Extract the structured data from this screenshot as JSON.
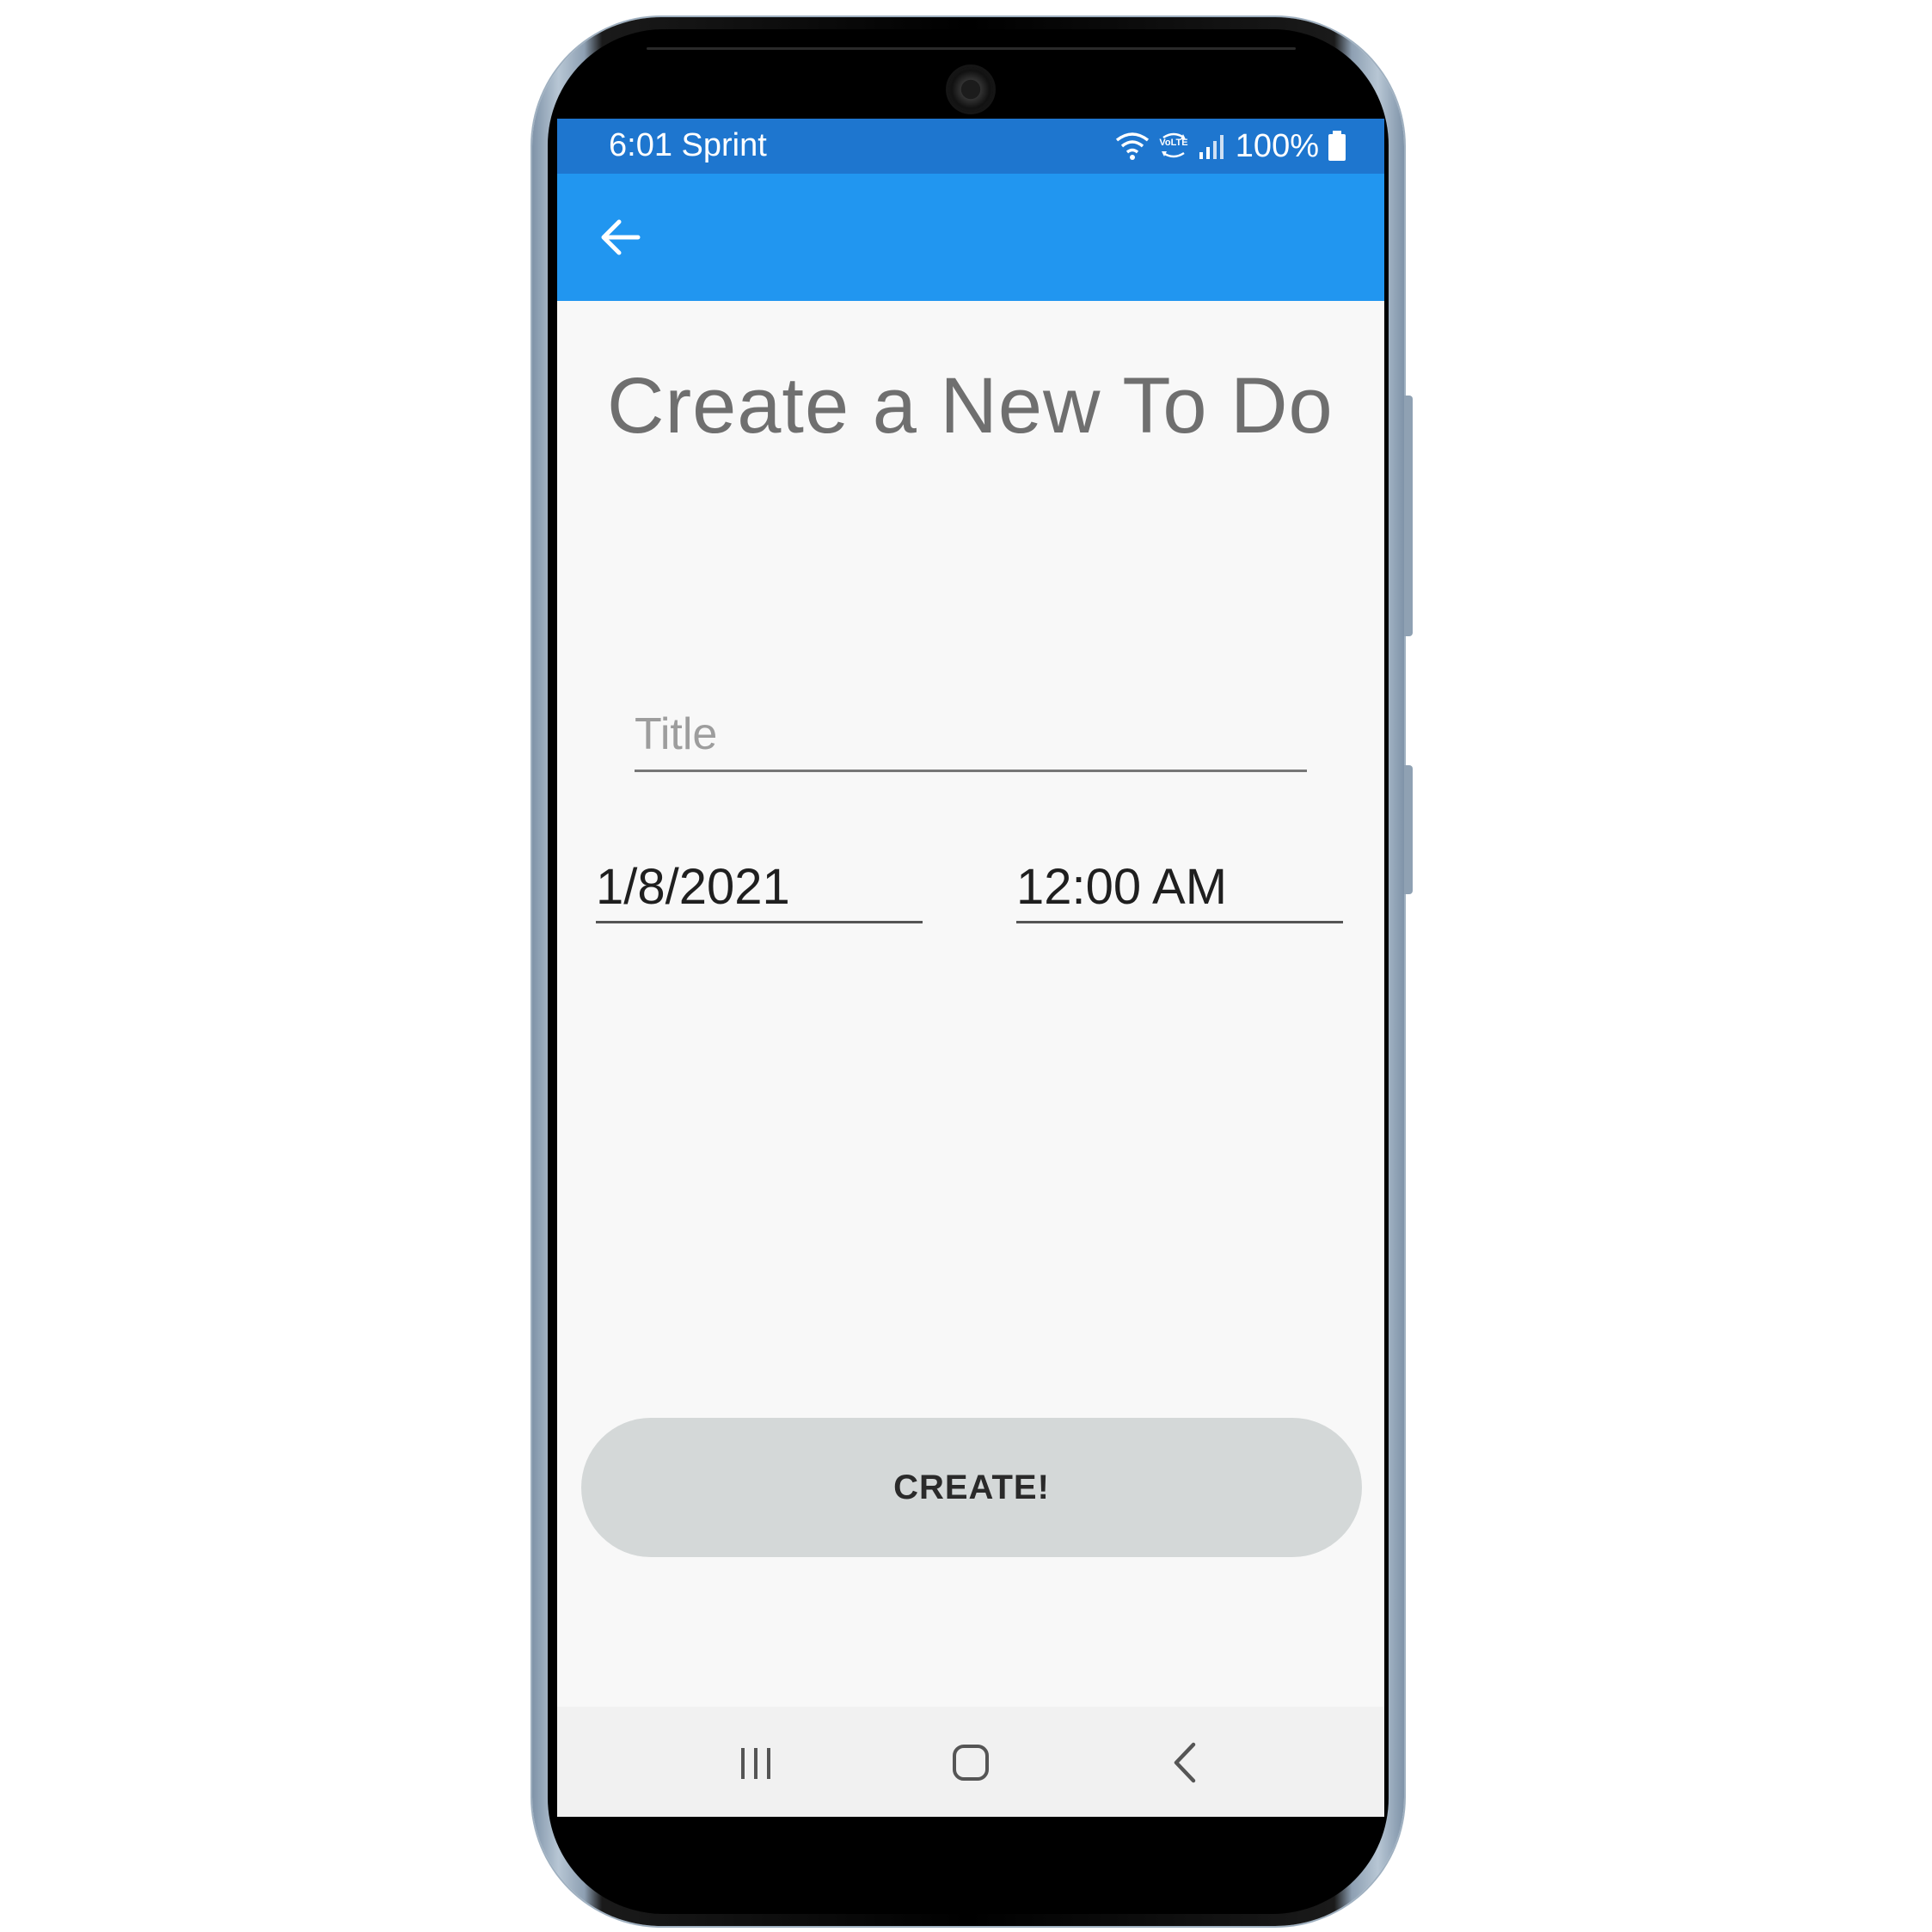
{
  "status_bar": {
    "time_carrier": "6:01 Sprint",
    "battery_percent": "100%",
    "icons": [
      "wifi-icon",
      "volte-icon",
      "signal-icon",
      "battery-icon"
    ]
  },
  "app_bar": {
    "back_icon": "arrow-left-icon",
    "color": "#2196f0"
  },
  "page": {
    "title": "Create a New To Do"
  },
  "form": {
    "title_placeholder": "Title",
    "title_value": "",
    "date_value": "1/8/2021",
    "time_value": "12:00 AM",
    "create_label": "CREATE!"
  },
  "nav_bar": {
    "icons": [
      "recent-apps-icon",
      "home-icon",
      "back-icon"
    ]
  },
  "colors": {
    "status_bar": "#1e76cf",
    "app_bar": "#2196f0",
    "button": "#d4d8d8",
    "background": "#f8f8f8"
  }
}
